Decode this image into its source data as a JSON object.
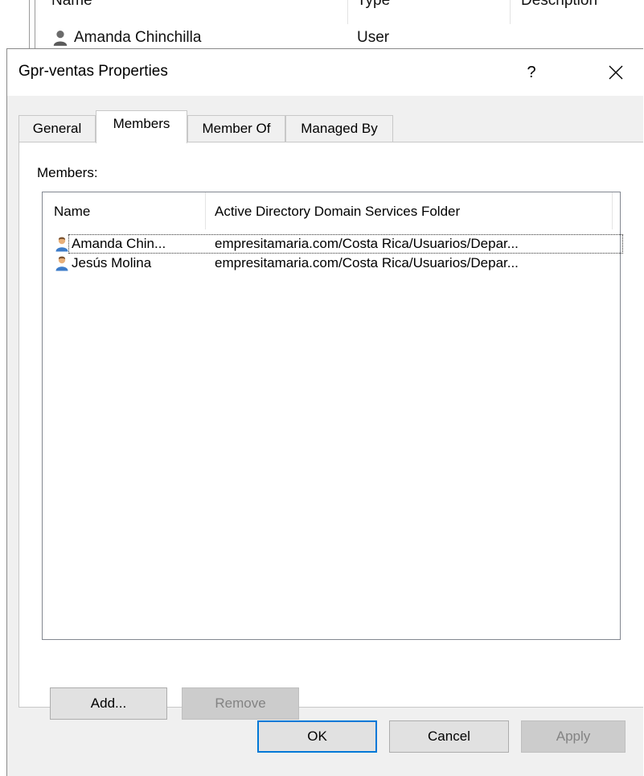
{
  "background_list": {
    "columns": [
      "Name",
      "Type",
      "Description"
    ],
    "row": {
      "name": "Amanda Chinchilla",
      "type": "User"
    }
  },
  "dialog": {
    "title": "Gpr-ventas Properties",
    "help_label": "?",
    "tabs": [
      {
        "label": "General",
        "active": false
      },
      {
        "label": "Members",
        "active": true
      },
      {
        "label": "Member Of",
        "active": false
      },
      {
        "label": "Managed By",
        "active": false
      }
    ],
    "members_label": "Members:",
    "list": {
      "columns": [
        "Name",
        "Active Directory Domain Services Folder"
      ],
      "rows": [
        {
          "name": "Amanda Chin...",
          "folder": "empresitamaria.com/Costa Rica/Usuarios/Depar...",
          "icon": "user-icon",
          "focused": true
        },
        {
          "name": "Jesús Molina",
          "folder": "empresitamaria.com/Costa Rica/Usuarios/Depar...",
          "icon": "user-icon",
          "focused": false
        }
      ]
    },
    "add_label": "Add...",
    "remove_label": "Remove",
    "ok_label": "OK",
    "cancel_label": "Cancel",
    "apply_label": "Apply"
  },
  "colors": {
    "accent": "#0078d7",
    "dialog_bg": "#f0f0f0"
  }
}
